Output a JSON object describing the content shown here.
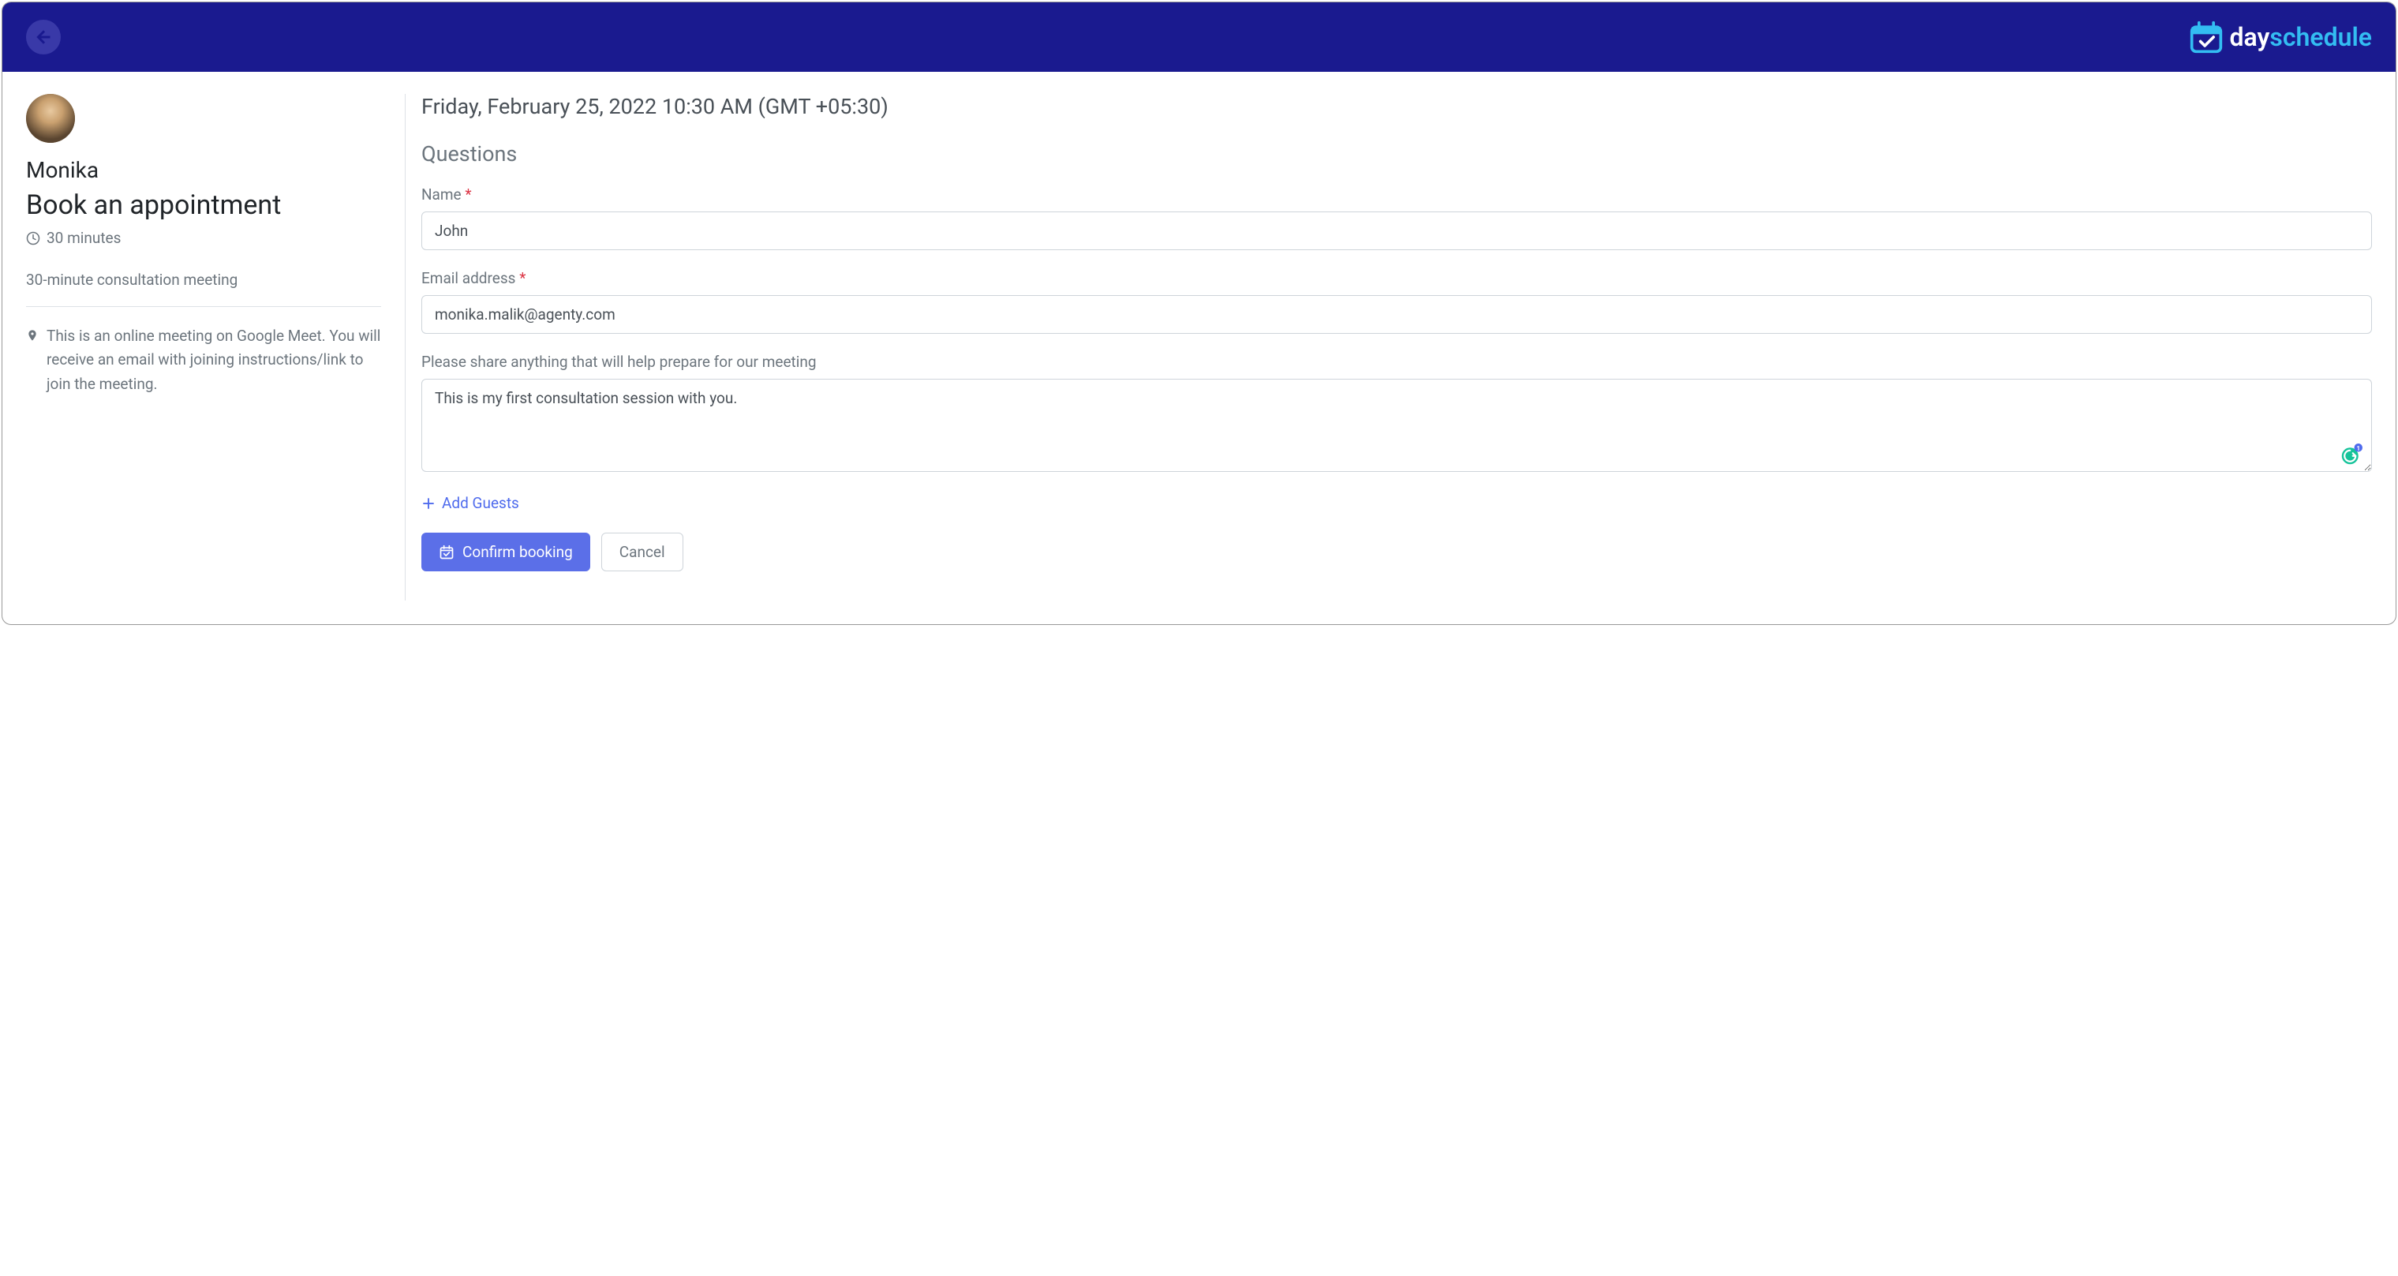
{
  "brand": {
    "name_part1": "day",
    "name_part2": "schedule"
  },
  "sidebar": {
    "host_name": "Monika",
    "title": "Book an appointment",
    "duration": "30 minutes",
    "description": "30-minute consultation meeting",
    "location_info": "This is an online meeting on Google Meet. You will receive an email with joining instructions/link to join the meeting."
  },
  "main": {
    "datetime": "Friday, February 25, 2022 10:30 AM (GMT +05:30)",
    "section_heading": "Questions",
    "fields": {
      "name": {
        "label": "Name",
        "value": "John"
      },
      "email": {
        "label": "Email address",
        "value": "monika.malik@agenty.com"
      },
      "notes": {
        "label": "Please share anything that will help prepare for our meeting",
        "value": "This is my first consultation session with you."
      }
    },
    "add_guests_label": "Add Guests",
    "confirm_label": "Confirm booking",
    "cancel_label": "Cancel",
    "grammarly_count": "1"
  }
}
